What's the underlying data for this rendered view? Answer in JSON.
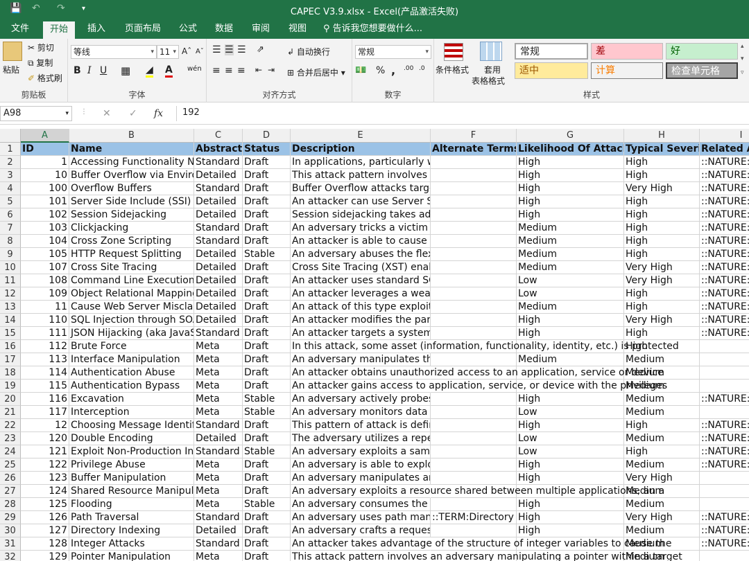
{
  "window": {
    "title": "CAPEC V3.9.xlsx - Excel(产品激活失败)"
  },
  "tabs": [
    "文件",
    "开始",
    "插入",
    "页面布局",
    "公式",
    "数据",
    "审阅",
    "视图"
  ],
  "tell_me": "告诉我您想要做什么...",
  "ribbon": {
    "clipboard": {
      "paste": "粘贴",
      "cut": "剪切",
      "copy": "复制",
      "format_painter": "格式刷",
      "label": "剪贴板"
    },
    "font": {
      "name": "等线",
      "size": "11",
      "bold": "B",
      "italic": "I",
      "underline": "U",
      "label": "字体"
    },
    "alignment": {
      "wrap": "自动换行",
      "merge": "合并后居中",
      "label": "对齐方式"
    },
    "number": {
      "format": "常规",
      "percent": "%",
      "comma": ",",
      "label": "数字"
    },
    "styles": {
      "conditional": "条件格式",
      "table_fmt": "套用",
      "table_fmt2": "表格格式",
      "label": "样式",
      "normal": "常规",
      "bad": "差",
      "good": "好",
      "neutral": "适中",
      "calc": "计算",
      "check": "检查单元格"
    }
  },
  "formula_bar": {
    "name_box": "A98",
    "cancel": "✕",
    "enter": "✓",
    "fx": "fx",
    "value": "192"
  },
  "columns": [
    "A",
    "B",
    "C",
    "D",
    "E",
    "F",
    "G",
    "H",
    "I"
  ],
  "rows": [
    {
      "n": "1",
      "cells": [
        "ID",
        "Name",
        "Abstraction",
        "Status",
        "Description",
        "Alternate Terms",
        "Likelihood Of Attack",
        "Typical Severity",
        "Related Attack Patterns"
      ]
    },
    {
      "n": "2",
      "cells": [
        "1",
        "Accessing Functionality Not Properly Constrained by ACLs",
        "Standard",
        "Draft",
        "In applications, particularly web applications, access",
        "",
        "High",
        "High",
        "::NATURE:ChildOf"
      ]
    },
    {
      "n": "3",
      "cells": [
        "10",
        "Buffer Overflow via Environment Variables",
        "Detailed",
        "Draft",
        "This attack pattern involves causing a buffer overflow",
        "",
        "High",
        "High",
        "::NATURE:ChildOf"
      ]
    },
    {
      "n": "4",
      "cells": [
        "100",
        "Overflow Buffers",
        "Standard",
        "Draft",
        "Buffer Overflow attacks target improper or missing",
        "",
        "High",
        "Very High",
        "::NATURE:ChildOf"
      ]
    },
    {
      "n": "5",
      "cells": [
        "101",
        "Server Side Include (SSI) Injection",
        "Detailed",
        "Draft",
        "An attacker can use Server Side Include (SSI) Injection",
        "",
        "High",
        "High",
        "::NATURE:ChildOf"
      ]
    },
    {
      "n": "6",
      "cells": [
        "102",
        "Session Sidejacking",
        "Detailed",
        "Draft",
        "Session sidejacking takes advantage of an unencrypted",
        "",
        "High",
        "High",
        "::NATURE:ChildOf"
      ]
    },
    {
      "n": "7",
      "cells": [
        "103",
        "Clickjacking",
        "Standard",
        "Draft",
        "An adversary tricks a victim into unknowingly initiating",
        "",
        "Medium",
        "High",
        "::NATURE:ChildOf"
      ]
    },
    {
      "n": "8",
      "cells": [
        "104",
        "Cross Zone Scripting",
        "Standard",
        "Draft",
        "An attacker is able to cause a victim to load content",
        "",
        "Medium",
        "High",
        "::NATURE:ChildOf"
      ]
    },
    {
      "n": "9",
      "cells": [
        "105",
        "HTTP Request Splitting",
        "Detailed",
        "Stable",
        "An adversary abuses the flexibility and discrepancies",
        "",
        "Medium",
        "High",
        "::NATURE:ChildOf"
      ]
    },
    {
      "n": "10",
      "cells": [
        "107",
        "Cross Site Tracing",
        "Detailed",
        "Draft",
        "Cross Site Tracing (XST) enables an adversary to steal",
        "",
        "Medium",
        "Very High",
        "::NATURE:ChildOf"
      ]
    },
    {
      "n": "11",
      "cells": [
        "108",
        "Command Line Execution through SQL Injection",
        "Detailed",
        "Draft",
        "An attacker uses standard SQL injection methods to",
        "",
        "Low",
        "Very High",
        "::NATURE:ChildOf"
      ]
    },
    {
      "n": "12",
      "cells": [
        "109",
        "Object Relational Mapping Injection",
        "Detailed",
        "Draft",
        "An attacker leverages a weakness present in the data",
        "",
        "Low",
        "High",
        "::NATURE:ChildOf"
      ]
    },
    {
      "n": "13",
      "cells": [
        "11",
        "Cause Web Server Misclassification",
        "Detailed",
        "Draft",
        "An attack of this type exploits a Web server's decision",
        "",
        "Medium",
        "High",
        "::NATURE:ChildOf"
      ]
    },
    {
      "n": "14",
      "cells": [
        "110",
        "SQL Injection through SOAP Parameter Tampering",
        "Detailed",
        "Draft",
        "An attacker modifies the parameters of the SOAP message",
        "",
        "High",
        "Very High",
        "::NATURE:ChildOf"
      ]
    },
    {
      "n": "15",
      "cells": [
        "111",
        "JSON Hijacking (aka JavaScript Hijacking)",
        "Standard",
        "Draft",
        "An attacker targets a system that uses JavaScript Object",
        "",
        "High",
        "High",
        "::NATURE:ChildOf"
      ]
    },
    {
      "n": "16",
      "cells": [
        "112",
        "Brute Force",
        "Meta",
        "Draft",
        "In this attack, some asset (information, functionality, identity, etc.) is protected",
        "",
        "",
        "High",
        ""
      ]
    },
    {
      "n": "17",
      "cells": [
        "113",
        "Interface Manipulation",
        "Meta",
        "Draft",
        "An adversary manipulates the use or processing of",
        "",
        "Medium",
        "Medium",
        ""
      ]
    },
    {
      "n": "18",
      "cells": [
        "114",
        "Authentication Abuse",
        "Meta",
        "Draft",
        "An attacker obtains unauthorized access to an application, service or device",
        "",
        "",
        "Medium",
        ""
      ]
    },
    {
      "n": "19",
      "cells": [
        "115",
        "Authentication Bypass",
        "Meta",
        "Draft",
        "An attacker gains access to application, service, or device with the privileges",
        "",
        "",
        "Medium",
        ""
      ]
    },
    {
      "n": "20",
      "cells": [
        "116",
        "Excavation",
        "Meta",
        "Stable",
        "An adversary actively probes the target in a manner",
        "",
        "High",
        "Medium",
        "::NATURE:ChildOf"
      ]
    },
    {
      "n": "21",
      "cells": [
        "117",
        "Interception",
        "Meta",
        "Stable",
        "An adversary monitors data streams to or from the",
        "",
        "Low",
        "Medium",
        ""
      ]
    },
    {
      "n": "22",
      "cells": [
        "12",
        "Choosing Message Identifier",
        "Standard",
        "Draft",
        "This pattern of attack is defined by the selection of",
        "",
        "High",
        "High",
        "::NATURE:ParentOf"
      ]
    },
    {
      "n": "23",
      "cells": [
        "120",
        "Double Encoding",
        "Detailed",
        "Draft",
        "The adversary utilizes a repeating of the encoding",
        "",
        "Low",
        "Medium",
        "::NATURE:ChildOf"
      ]
    },
    {
      "n": "24",
      "cells": [
        "121",
        "Exploit Non-Production Interfaces",
        "Standard",
        "Stable",
        "An adversary exploits a sample, demonstration, test",
        "",
        "Low",
        "High",
        "::NATURE:ChildOf"
      ]
    },
    {
      "n": "25",
      "cells": [
        "122",
        "Privilege Abuse",
        "Meta",
        "Draft",
        "An adversary is able to exploit features of the target",
        "",
        "High",
        "Medium",
        "::NATURE:ChildOf"
      ]
    },
    {
      "n": "26",
      "cells": [
        "123",
        "Buffer Manipulation",
        "Meta",
        "Draft",
        "An adversary manipulates an application's interaction",
        "",
        "High",
        "Very High",
        ""
      ]
    },
    {
      "n": "27",
      "cells": [
        "124",
        "Shared Resource Manipulation",
        "Meta",
        "Draft",
        "An adversary exploits a resource shared between multiple applications, an a",
        "",
        "",
        "Medium",
        ""
      ]
    },
    {
      "n": "28",
      "cells": [
        "125",
        "Flooding",
        "Meta",
        "Stable",
        "An adversary consumes the resources of a target by",
        "",
        "High",
        "Medium",
        ""
      ]
    },
    {
      "n": "29",
      "cells": [
        "126",
        "Path Traversal",
        "Standard",
        "Draft",
        "An adversary uses path manipulation",
        "::TERM:Directory Traversal",
        "High",
        "Very High",
        "::NATURE:ChildOf"
      ]
    },
    {
      "n": "30",
      "cells": [
        "127",
        "Directory Indexing",
        "Detailed",
        "Draft",
        "An adversary crafts a request to a target that results",
        "",
        "High",
        "Medium",
        "::NATURE:ChildOf"
      ]
    },
    {
      "n": "31",
      "cells": [
        "128",
        "Integer Attacks",
        "Standard",
        "Draft",
        "An attacker takes advantage of the structure of integer variables to cause the",
        "",
        "",
        "Medium",
        "::NATURE:ChildOf"
      ]
    },
    {
      "n": "32",
      "cells": [
        "129",
        "Pointer Manipulation",
        "Meta",
        "Draft",
        "This attack pattern involves an adversary manipulating a pointer within a target",
        "",
        "",
        "Medium",
        ""
      ]
    }
  ]
}
